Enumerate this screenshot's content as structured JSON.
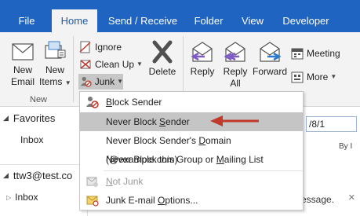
{
  "tabs": [
    "File",
    "Home",
    "Send / Receive",
    "Folder",
    "View",
    "Developer"
  ],
  "ribbon": {
    "new_email": [
      "New",
      "Email"
    ],
    "new_items": [
      "New",
      "Items"
    ],
    "new_group_label": "New",
    "ignore": "Ignore",
    "clean_up": "Clean Up",
    "junk": "Junk",
    "delete": "Delete",
    "reply": "Reply",
    "reply_all": [
      "Reply",
      "All"
    ],
    "forward": "Forward",
    "meeting": "Meeting",
    "more": "More"
  },
  "left_pane": {
    "favorites": "Favorites",
    "inbox": "Inbox",
    "account": "ttw3@test.co",
    "inbox2": "Inbox"
  },
  "right_pane": {
    "date_fragment": "/8/1",
    "by_fragment": "By I",
    "message_fragment": "message."
  },
  "junk_menu": {
    "items": [
      {
        "label": "Block Sender",
        "underline": "B",
        "icon": "block-sender-icon",
        "state": "normal"
      },
      {
        "label": "Never Block Sender",
        "underline": "S",
        "icon": "",
        "state": "highlighted"
      },
      {
        "label": "Never Block Sender's Domain (@example.com)",
        "underline": "D",
        "icon": "",
        "state": "normal"
      },
      {
        "label": "Never Block this Group or Mailing List",
        "underline": "M",
        "icon": "",
        "state": "normal"
      },
      {
        "label": "Not Junk",
        "underline": "N",
        "icon": "not-junk-icon",
        "state": "disabled"
      },
      {
        "label": "Junk E-mail Options...",
        "underline": "O",
        "icon": "junk-options-icon",
        "state": "normal"
      }
    ]
  },
  "colors": {
    "tabbar": "#1e64c0",
    "ribbon": "#f3f3f3",
    "arrow": "#c0392b",
    "highlight": "#c5c5c5"
  }
}
